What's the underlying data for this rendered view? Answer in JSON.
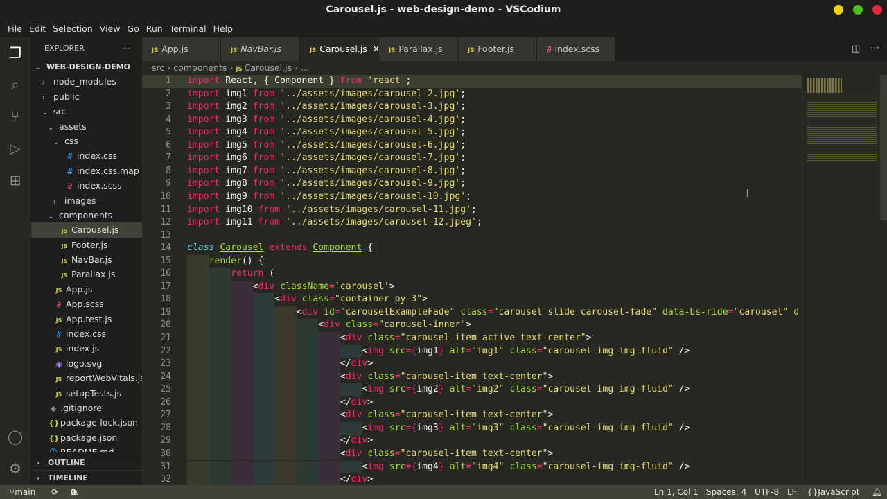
{
  "window": {
    "title": "Carousel.js - web-design-demo - VSCodium"
  },
  "menu": [
    "File",
    "Edit",
    "Selection",
    "View",
    "Go",
    "Run",
    "Terminal",
    "Help"
  ],
  "explorer": {
    "title": "EXPLORER",
    "more": "···",
    "root": "WEB-DESIGN-DEMO",
    "items": [
      {
        "label": "node_modules",
        "depth": 1,
        "type": "folder",
        "open": false
      },
      {
        "label": "public",
        "depth": 1,
        "type": "folder",
        "open": false
      },
      {
        "label": "src",
        "depth": 1,
        "type": "folder",
        "open": true
      },
      {
        "label": "assets",
        "depth": 2,
        "type": "folder",
        "open": true
      },
      {
        "label": "css",
        "depth": 3,
        "type": "folder",
        "open": true
      },
      {
        "label": "index.css",
        "depth": 4,
        "type": "css"
      },
      {
        "label": "index.css.map",
        "depth": 4,
        "type": "css"
      },
      {
        "label": "index.scss",
        "depth": 4,
        "type": "scss"
      },
      {
        "label": "images",
        "depth": 3,
        "type": "folder",
        "open": false
      },
      {
        "label": "components",
        "depth": 2,
        "type": "folder",
        "open": true
      },
      {
        "label": "Carousel.js",
        "depth": 3,
        "type": "js",
        "selected": true
      },
      {
        "label": "Footer.js",
        "depth": 3,
        "type": "js"
      },
      {
        "label": "NavBar.js",
        "depth": 3,
        "type": "js"
      },
      {
        "label": "Parallax.js",
        "depth": 3,
        "type": "js"
      },
      {
        "label": "App.js",
        "depth": 2,
        "type": "js"
      },
      {
        "label": "App.scss",
        "depth": 2,
        "type": "scss"
      },
      {
        "label": "App.test.js",
        "depth": 2,
        "type": "js"
      },
      {
        "label": "index.css",
        "depth": 2,
        "type": "css"
      },
      {
        "label": "index.js",
        "depth": 2,
        "type": "js"
      },
      {
        "label": "logo.svg",
        "depth": 2,
        "type": "svg"
      },
      {
        "label": "reportWebVitals.js",
        "depth": 2,
        "type": "js"
      },
      {
        "label": "setupTests.js",
        "depth": 2,
        "type": "js"
      },
      {
        "label": ".gitignore",
        "depth": 1,
        "type": "git"
      },
      {
        "label": "package-lock.json",
        "depth": 1,
        "type": "json"
      },
      {
        "label": "package.json",
        "depth": 1,
        "type": "json"
      },
      {
        "label": "README.md",
        "depth": 1,
        "type": "info"
      }
    ],
    "outline": "OUTLINE",
    "timeline": "TIMELINE"
  },
  "tabs": [
    {
      "label": "App.js",
      "italic": false,
      "active": false
    },
    {
      "label": "NavBar.js",
      "italic": true,
      "active": false
    },
    {
      "label": "Carousel.js",
      "italic": false,
      "active": true
    },
    {
      "label": "Parallax.js",
      "italic": false,
      "active": false
    },
    {
      "label": "Footer.js",
      "italic": false,
      "active": false
    },
    {
      "label": "index.scss",
      "italic": false,
      "active": false,
      "scss": true
    }
  ],
  "breadcrumb": [
    "src",
    "components",
    "Carousel.js",
    "..."
  ],
  "code": [
    [
      [
        "k",
        "import"
      ],
      [
        "p",
        " React, { Component } "
      ],
      [
        "k",
        "from"
      ],
      [
        "p",
        " "
      ],
      [
        "s",
        "'react'"
      ],
      [
        "p",
        ";"
      ]
    ],
    [
      [
        "k",
        "import"
      ],
      [
        "p",
        " img1 "
      ],
      [
        "k",
        "from"
      ],
      [
        "p",
        " "
      ],
      [
        "s",
        "'../assets/images/carousel-2.jpg'"
      ],
      [
        "p",
        ";"
      ]
    ],
    [
      [
        "k",
        "import"
      ],
      [
        "p",
        " img2 "
      ],
      [
        "k",
        "from"
      ],
      [
        "p",
        " "
      ],
      [
        "s",
        "'../assets/images/carousel-3.jpg'"
      ],
      [
        "p",
        ";"
      ]
    ],
    [
      [
        "k",
        "import"
      ],
      [
        "p",
        " img3 "
      ],
      [
        "k",
        "from"
      ],
      [
        "p",
        " "
      ],
      [
        "s",
        "'../assets/images/carousel-4.jpg'"
      ],
      [
        "p",
        ";"
      ]
    ],
    [
      [
        "k",
        "import"
      ],
      [
        "p",
        " img4 "
      ],
      [
        "k",
        "from"
      ],
      [
        "p",
        " "
      ],
      [
        "s",
        "'../assets/images/carousel-5.jpg'"
      ],
      [
        "p",
        ";"
      ]
    ],
    [
      [
        "k",
        "import"
      ],
      [
        "p",
        " img5 "
      ],
      [
        "k",
        "from"
      ],
      [
        "p",
        " "
      ],
      [
        "s",
        "'../assets/images/carousel-6.jpg'"
      ],
      [
        "p",
        ";"
      ]
    ],
    [
      [
        "k",
        "import"
      ],
      [
        "p",
        " img6 "
      ],
      [
        "k",
        "from"
      ],
      [
        "p",
        " "
      ],
      [
        "s",
        "'../assets/images/carousel-7.jpg'"
      ],
      [
        "p",
        ";"
      ]
    ],
    [
      [
        "k",
        "import"
      ],
      [
        "p",
        " img7 "
      ],
      [
        "k",
        "from"
      ],
      [
        "p",
        " "
      ],
      [
        "s",
        "'../assets/images/carousel-8.jpg'"
      ],
      [
        "p",
        ";"
      ]
    ],
    [
      [
        "k",
        "import"
      ],
      [
        "p",
        " img8 "
      ],
      [
        "k",
        "from"
      ],
      [
        "p",
        " "
      ],
      [
        "s",
        "'../assets/images/carousel-9.jpg'"
      ],
      [
        "p",
        ";"
      ]
    ],
    [
      [
        "k",
        "import"
      ],
      [
        "p",
        " img9 "
      ],
      [
        "k",
        "from"
      ],
      [
        "p",
        " "
      ],
      [
        "s",
        "'../assets/images/carousel-10.jpg'"
      ],
      [
        "p",
        ";"
      ]
    ],
    [
      [
        "k",
        "import"
      ],
      [
        "p",
        " img10 "
      ],
      [
        "k",
        "from"
      ],
      [
        "p",
        " "
      ],
      [
        "s",
        "'../assets/images/carousel-11.jpg'"
      ],
      [
        "p",
        ";"
      ]
    ],
    [
      [
        "k",
        "import"
      ],
      [
        "p",
        " img11 "
      ],
      [
        "k",
        "from"
      ],
      [
        "p",
        " "
      ],
      [
        "s",
        "'../assets/images/carousel-12.jpeg'"
      ],
      [
        "p",
        ";"
      ]
    ],
    [],
    [
      [
        "c",
        "class"
      ],
      [
        "p",
        " "
      ],
      [
        "u",
        "Carousel"
      ],
      [
        "p",
        " "
      ],
      [
        "k",
        "extends"
      ],
      [
        "p",
        " "
      ],
      [
        "u",
        "Component"
      ],
      [
        "p",
        " {"
      ]
    ],
    [
      [
        "i",
        1
      ],
      [
        "a",
        "render"
      ],
      [
        "p",
        "() {"
      ]
    ],
    [
      [
        "i",
        2
      ],
      [
        "k",
        "return"
      ],
      [
        "p",
        " ("
      ]
    ],
    [
      [
        "i",
        3
      ],
      [
        "p",
        "<"
      ],
      [
        "t",
        "div"
      ],
      [
        "p",
        " "
      ],
      [
        "a",
        "className"
      ],
      [
        "k",
        "="
      ],
      [
        "s",
        "'carousel'"
      ],
      [
        "p",
        ">"
      ]
    ],
    [
      [
        "i",
        4
      ],
      [
        "p",
        "<"
      ],
      [
        "t",
        "div"
      ],
      [
        "p",
        " "
      ],
      [
        "a",
        "class"
      ],
      [
        "k",
        "="
      ],
      [
        "s",
        "\"container py-3\""
      ],
      [
        "p",
        ">"
      ]
    ],
    [
      [
        "i",
        5
      ],
      [
        "p",
        "<"
      ],
      [
        "t",
        "div"
      ],
      [
        "p",
        " "
      ],
      [
        "a",
        "id"
      ],
      [
        "k",
        "="
      ],
      [
        "s",
        "\"carouselExampleFade\""
      ],
      [
        "p",
        " "
      ],
      [
        "a",
        "class"
      ],
      [
        "k",
        "="
      ],
      [
        "s",
        "\"carousel slide carousel-fade\""
      ],
      [
        "p",
        " "
      ],
      [
        "a",
        "data-bs-ride"
      ],
      [
        "k",
        "="
      ],
      [
        "s",
        "\"carousel\""
      ],
      [
        "p",
        " "
      ],
      [
        "a",
        "d"
      ]
    ],
    [
      [
        "i",
        6
      ],
      [
        "p",
        "<"
      ],
      [
        "t",
        "div"
      ],
      [
        "p",
        " "
      ],
      [
        "a",
        "class"
      ],
      [
        "k",
        "="
      ],
      [
        "s",
        "\"carousel-inner\""
      ],
      [
        "p",
        ">"
      ]
    ],
    [
      [
        "i",
        7
      ],
      [
        "p",
        "<"
      ],
      [
        "t",
        "div"
      ],
      [
        "p",
        " "
      ],
      [
        "a",
        "class"
      ],
      [
        "k",
        "="
      ],
      [
        "s",
        "\"carousel-item active text-center\""
      ],
      [
        "p",
        ">"
      ]
    ],
    [
      [
        "i",
        8
      ],
      [
        "p",
        "<"
      ],
      [
        "t",
        "img"
      ],
      [
        "p",
        " "
      ],
      [
        "a",
        "src"
      ],
      [
        "k",
        "="
      ],
      [
        "k",
        "{"
      ],
      [
        "p",
        "img1"
      ],
      [
        "k",
        "}"
      ],
      [
        "p",
        " "
      ],
      [
        "a",
        "alt"
      ],
      [
        "k",
        "="
      ],
      [
        "s",
        "\"img1\""
      ],
      [
        "p",
        " "
      ],
      [
        "a",
        "class"
      ],
      [
        "k",
        "="
      ],
      [
        "s",
        "\"carousel-img img-fluid\""
      ],
      [
        "p",
        " />"
      ]
    ],
    [
      [
        "i",
        7
      ],
      [
        "p",
        "</"
      ],
      [
        "t",
        "div"
      ],
      [
        "p",
        ">"
      ]
    ],
    [
      [
        "i",
        7
      ],
      [
        "p",
        "<"
      ],
      [
        "t",
        "div"
      ],
      [
        "p",
        " "
      ],
      [
        "a",
        "class"
      ],
      [
        "k",
        "="
      ],
      [
        "s",
        "\"carousel-item text-center\""
      ],
      [
        "p",
        ">"
      ]
    ],
    [
      [
        "i",
        8
      ],
      [
        "p",
        "<"
      ],
      [
        "t",
        "img"
      ],
      [
        "p",
        " "
      ],
      [
        "a",
        "src"
      ],
      [
        "k",
        "="
      ],
      [
        "k",
        "{"
      ],
      [
        "p",
        "img2"
      ],
      [
        "k",
        "}"
      ],
      [
        "p",
        " "
      ],
      [
        "a",
        "alt"
      ],
      [
        "k",
        "="
      ],
      [
        "s",
        "\"img2\""
      ],
      [
        "p",
        " "
      ],
      [
        "a",
        "class"
      ],
      [
        "k",
        "="
      ],
      [
        "s",
        "\"carousel-img img-fluid\""
      ],
      [
        "p",
        " />"
      ]
    ],
    [
      [
        "i",
        7
      ],
      [
        "p",
        "</"
      ],
      [
        "t",
        "div"
      ],
      [
        "p",
        ">"
      ]
    ],
    [
      [
        "i",
        7
      ],
      [
        "p",
        "<"
      ],
      [
        "t",
        "div"
      ],
      [
        "p",
        " "
      ],
      [
        "a",
        "class"
      ],
      [
        "k",
        "="
      ],
      [
        "s",
        "\"carousel-item text-center\""
      ],
      [
        "p",
        ">"
      ]
    ],
    [
      [
        "i",
        8
      ],
      [
        "p",
        "<"
      ],
      [
        "t",
        "img"
      ],
      [
        "p",
        " "
      ],
      [
        "a",
        "src"
      ],
      [
        "k",
        "="
      ],
      [
        "k",
        "{"
      ],
      [
        "p",
        "img3"
      ],
      [
        "k",
        "}"
      ],
      [
        "p",
        " "
      ],
      [
        "a",
        "alt"
      ],
      [
        "k",
        "="
      ],
      [
        "s",
        "\"img3\""
      ],
      [
        "p",
        " "
      ],
      [
        "a",
        "class"
      ],
      [
        "k",
        "="
      ],
      [
        "s",
        "\"carousel-img img-fluid\""
      ],
      [
        "p",
        " />"
      ]
    ],
    [
      [
        "i",
        7
      ],
      [
        "p",
        "</"
      ],
      [
        "t",
        "div"
      ],
      [
        "p",
        ">"
      ]
    ],
    [
      [
        "i",
        7
      ],
      [
        "p",
        "<"
      ],
      [
        "t",
        "div"
      ],
      [
        "p",
        " "
      ],
      [
        "a",
        "class"
      ],
      [
        "k",
        "="
      ],
      [
        "s",
        "\"carousel-item text-center\""
      ],
      [
        "p",
        ">"
      ]
    ],
    [
      [
        "i",
        8
      ],
      [
        "p",
        "<"
      ],
      [
        "t",
        "img"
      ],
      [
        "p",
        " "
      ],
      [
        "a",
        "src"
      ],
      [
        "k",
        "="
      ],
      [
        "k",
        "{"
      ],
      [
        "p",
        "img4"
      ],
      [
        "k",
        "}"
      ],
      [
        "p",
        " "
      ],
      [
        "a",
        "alt"
      ],
      [
        "k",
        "="
      ],
      [
        "s",
        "\"img4\""
      ],
      [
        "p",
        " "
      ],
      [
        "a",
        "class"
      ],
      [
        "k",
        "="
      ],
      [
        "s",
        "\"carousel-img img-fluid\""
      ],
      [
        "p",
        " />"
      ]
    ],
    [
      [
        "i",
        7
      ],
      [
        "p",
        "</"
      ],
      [
        "t",
        "div"
      ],
      [
        "p",
        ">"
      ]
    ]
  ],
  "status": {
    "branch": "main",
    "errors": "0",
    "warnings": "0",
    "position": "Ln 1, Col 1",
    "spaces": "Spaces: 4",
    "encoding": "UTF-8",
    "eol": "LF",
    "language": "JavaScript"
  },
  "colors": {
    "background": "#272822",
    "statusbar": "#414339",
    "keyword": "#f92672",
    "string": "#e6db74",
    "attr": "#a6e22e"
  }
}
